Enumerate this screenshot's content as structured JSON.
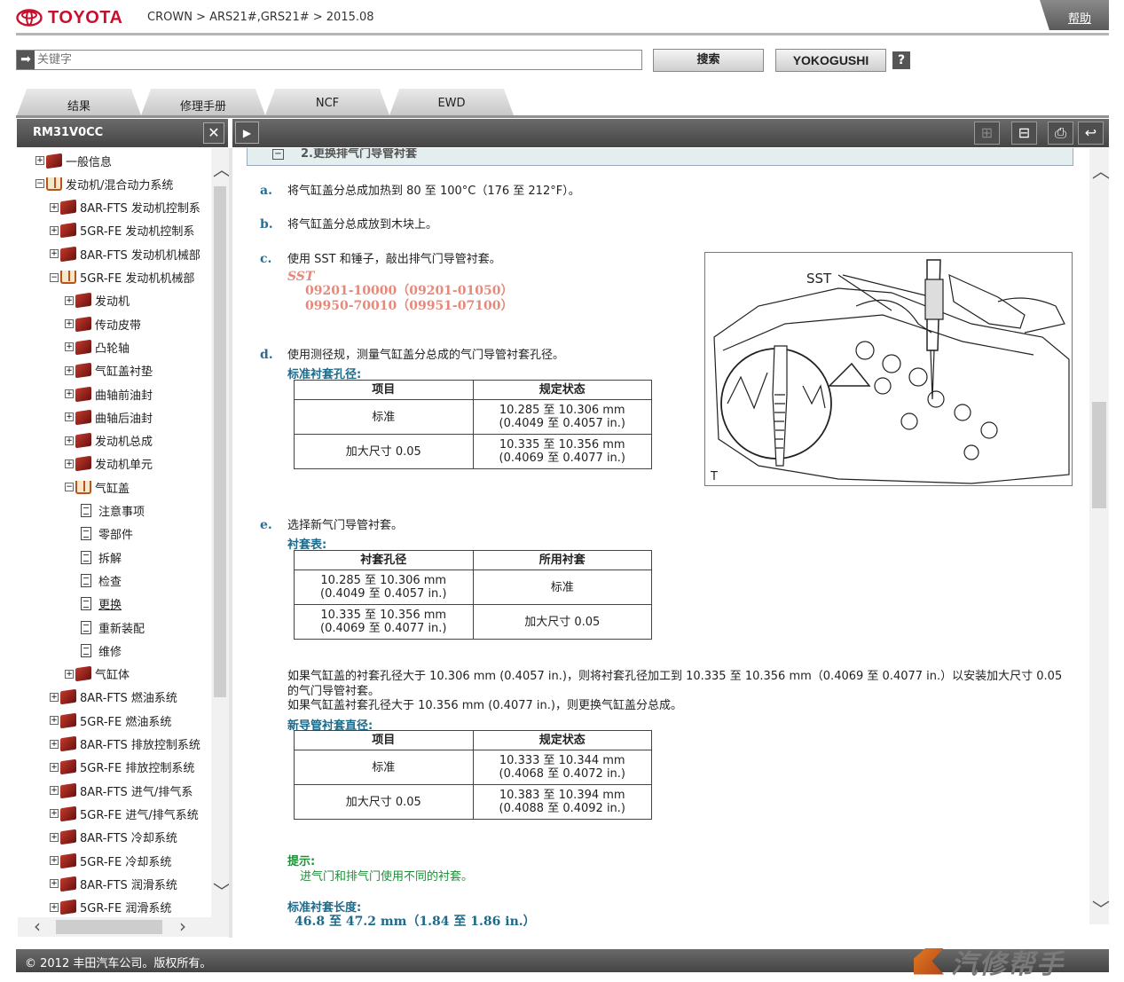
{
  "header": {
    "brand": "TOYOTA",
    "breadcrumb": "CROWN > ARS21#,GRS21# > 2015.08",
    "help": "帮助"
  },
  "search": {
    "placeholder": "关键字",
    "search_button": "搜索",
    "yokogushi_button": "YOKOGUSHI",
    "help_button": "?"
  },
  "tabs": [
    "结果",
    "修理手册",
    "NCF",
    "EWD"
  ],
  "left_panel": {
    "title": "RM31V0CC"
  },
  "tree": [
    {
      "label": "一般信息",
      "level": 0,
      "type": "closed",
      "toggle": "+"
    },
    {
      "label": "发动机/混合动力系统",
      "level": 0,
      "type": "open",
      "toggle": "−"
    },
    {
      "label": "8AR-FTS 发动机控制系",
      "level": 1,
      "type": "closed",
      "toggle": "+"
    },
    {
      "label": "5GR-FE 发动机控制系",
      "level": 1,
      "type": "closed",
      "toggle": "+"
    },
    {
      "label": "8AR-FTS 发动机机械部",
      "level": 1,
      "type": "closed",
      "toggle": "+"
    },
    {
      "label": "5GR-FE 发动机机械部",
      "level": 1,
      "type": "open",
      "toggle": "−"
    },
    {
      "label": "发动机",
      "level": 2,
      "type": "closed",
      "toggle": "+"
    },
    {
      "label": "传动皮带",
      "level": 2,
      "type": "closed",
      "toggle": "+"
    },
    {
      "label": "凸轮轴",
      "level": 2,
      "type": "closed",
      "toggle": "+"
    },
    {
      "label": "气缸盖衬垫",
      "level": 2,
      "type": "closed",
      "toggle": "+"
    },
    {
      "label": "曲轴前油封",
      "level": 2,
      "type": "closed",
      "toggle": "+"
    },
    {
      "label": "曲轴后油封",
      "level": 2,
      "type": "closed",
      "toggle": "+"
    },
    {
      "label": "发动机总成",
      "level": 2,
      "type": "closed",
      "toggle": "+"
    },
    {
      "label": "发动机单元",
      "level": 2,
      "type": "closed",
      "toggle": "+"
    },
    {
      "label": "气缸盖",
      "level": 2,
      "type": "open",
      "toggle": "−"
    },
    {
      "label": "注意事项",
      "level": 3,
      "type": "doc"
    },
    {
      "label": "零部件",
      "level": 3,
      "type": "doc"
    },
    {
      "label": "拆解",
      "level": 3,
      "type": "doc"
    },
    {
      "label": "检查",
      "level": 3,
      "type": "doc"
    },
    {
      "label": "更换",
      "level": 3,
      "type": "doc",
      "selected": true
    },
    {
      "label": "重新装配",
      "level": 3,
      "type": "doc"
    },
    {
      "label": "维修",
      "level": 3,
      "type": "doc"
    },
    {
      "label": "气缸体",
      "level": 2,
      "type": "closed",
      "toggle": "+"
    },
    {
      "label": "8AR-FTS 燃油系统",
      "level": 1,
      "type": "closed",
      "toggle": "+"
    },
    {
      "label": "5GR-FE 燃油系统",
      "level": 1,
      "type": "closed",
      "toggle": "+"
    },
    {
      "label": "8AR-FTS 排放控制系统",
      "level": 1,
      "type": "closed",
      "toggle": "+"
    },
    {
      "label": "5GR-FE 排放控制系统",
      "level": 1,
      "type": "closed",
      "toggle": "+"
    },
    {
      "label": "8AR-FTS 进气/排气系",
      "level": 1,
      "type": "closed",
      "toggle": "+"
    },
    {
      "label": "5GR-FE 进气/排气系统",
      "level": 1,
      "type": "closed",
      "toggle": "+"
    },
    {
      "label": "8AR-FTS 冷却系统",
      "level": 1,
      "type": "closed",
      "toggle": "+"
    },
    {
      "label": "5GR-FE 冷却系统",
      "level": 1,
      "type": "closed",
      "toggle": "+"
    },
    {
      "label": "8AR-FTS 润滑系统",
      "level": 1,
      "type": "closed",
      "toggle": "+"
    },
    {
      "label": "5GR-FE 润滑系统",
      "level": 1,
      "type": "closed",
      "toggle": "+"
    }
  ],
  "content": {
    "section_title": "2.更换排气门导管衬套",
    "section_toggle": "−",
    "steps": {
      "a": {
        "letter": "a.",
        "text": "将气缸盖分总成加热到 80 至 100°C（176 至 212°F）。"
      },
      "b": {
        "letter": "b.",
        "text": "将气缸盖分总成放到木块上。"
      },
      "c": {
        "letter": "c.",
        "text": "使用 SST 和锤子，敲出排气门导管衬套。",
        "sst_label": "SST",
        "sst_line1": "09201-10000（09201-01050）",
        "sst_line2": "09950-70010（09951-07100）"
      },
      "d": {
        "letter": "d.",
        "text": "使用测径规，测量气缸盖分总成的气门导管衬套孔径。",
        "table_title": "标准衬套孔径:"
      },
      "e": {
        "letter": "e.",
        "text": "选择新气门导管衬套。",
        "table_title": "衬套表:"
      }
    },
    "table_d": {
      "headers": [
        "项目",
        "规定状态"
      ],
      "rows": [
        [
          "标准",
          "10.285 至 10.306 mm\n(0.4049 至 0.4057 in.)"
        ],
        [
          "加大尺寸 0.05",
          "10.335 至 10.356 mm\n(0.4069 至 0.4077 in.)"
        ]
      ]
    },
    "table_e": {
      "headers": [
        "衬套孔径",
        "所用衬套"
      ],
      "rows": [
        [
          "10.285 至 10.306 mm\n(0.4049 至 0.4057 in.)",
          "标准"
        ],
        [
          "10.335 至 10.356 mm\n(0.4069 至 0.4077 in.)",
          "加大尺寸 0.05"
        ]
      ]
    },
    "paragraph1": "如果气缸盖的衬套孔径大于 10.306 mm (0.4057 in.)，则将衬套孔径加工到 10.335 至 10.356 mm（0.4069 至 0.4077 in.）以安装加大尺寸 0.05 的气门导管衬套。",
    "paragraph2": "如果气缸盖衬套孔径大于 10.356 mm (0.4077 in.)，则更换气缸盖分总成。",
    "table_f_title": "新导管衬套直径:",
    "table_f": {
      "headers": [
        "项目",
        "规定状态"
      ],
      "rows": [
        [
          "标准",
          "10.333 至 10.344 mm\n(0.4068 至 0.4072 in.)"
        ],
        [
          "加大尺寸 0.05",
          "10.383 至 10.394 mm\n(0.4088 至 0.4092 in.)"
        ]
      ]
    },
    "hint_title": "提示:",
    "hint_text": "进气门和排气门使用不同的衬套。",
    "length_title": "标准衬套长度:",
    "length_value": "46.8 至 47.2 mm（1.84 至 1.86 in.）",
    "figure": {
      "label_sst": "SST",
      "label_t": "T"
    }
  },
  "footer": {
    "copyright": "© 2012 丰田汽车公司。版权所有。"
  },
  "watermark": {
    "text": "汽修帮手"
  },
  "colors": {
    "brand_red": "#c8102e",
    "step_blue": "#2a6d92",
    "sst_pink": "#e6897a",
    "hint_green": "#1f8f3a"
  }
}
